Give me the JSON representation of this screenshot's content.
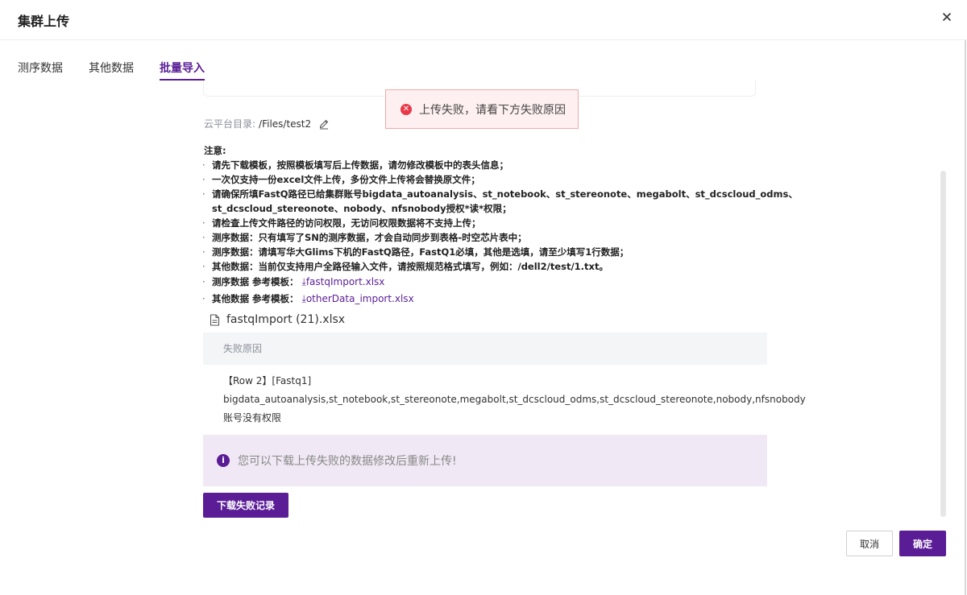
{
  "dialog": {
    "title": "集群上传",
    "close_icon": "close-icon"
  },
  "tabs": [
    {
      "label": "测序数据",
      "active": false
    },
    {
      "label": "其他数据",
      "active": false
    },
    {
      "label": "批量导入",
      "active": true
    }
  ],
  "toast": {
    "message": "上传失败，请看下方失败原因",
    "icon": "error-icon",
    "icon_glyph": "✕",
    "color": "#e8394a"
  },
  "directory": {
    "label": "云平台目录:",
    "value": "/Files/test2",
    "edit_icon": "pencil-icon"
  },
  "notes": {
    "heading": "注意:",
    "bullet": "·",
    "items": [
      "请先下载模板，按照模板填写后上传数据，请勿修改模板中的表头信息；",
      "一次仅支持一份excel文件上传，多份文件上传将会替换原文件；",
      "请确保所填FastQ路径已给集群账号bigdata_autoanalysis、st_notebook、st_stereonote、megabolt、st_dcscloud_odms、",
      "st_dcscloud_stereonote、nobody、nfsnobody授权*读*权限；",
      "请检查上传文件路径的访问权限，无访问权限数据将不支持上传；",
      "测序数据：只有填写了SN的测序数据，才会自动同步到表格-时空芯片表中；",
      "测序数据：请填写华大Glims下机的FastQ路径，FastQ1必填，其他是选填，请至少填写1行数据；",
      "其他数据：当前仅支持用户全路径输入文件，请按照规范格式填写，例如：/dell2/test/1.txt。"
    ],
    "templates": [
      {
        "label": "测序数据 参考模板：",
        "link": "⤓fastqImport.xlsx"
      },
      {
        "label": "其他数据 参考模板：",
        "link": "⤓otherData_import.xlsx"
      }
    ]
  },
  "uploaded_file": {
    "name": "fastqImport (21).xlsx",
    "icon": "document-icon"
  },
  "failure": {
    "header": "失败原因",
    "lines": [
      "【Row 2】[Fastq1]",
      "bigdata_autoanalysis,st_notebook,st_stereonote,megabolt,st_dcscloud_odms,st_dcscloud_stereonote,nobody,nfsnobody",
      "账号没有权限"
    ]
  },
  "info": {
    "icon": "info-icon",
    "icon_glyph": "i",
    "message": "您可以下载上传失败的数据修改后重新上传!"
  },
  "buttons": {
    "download_failed": "下载失败记录",
    "cancel": "取消",
    "confirm": "确定"
  },
  "colors": {
    "accent": "#5a1d96",
    "error": "#e8394a",
    "info_bg": "#f0e8f4"
  }
}
